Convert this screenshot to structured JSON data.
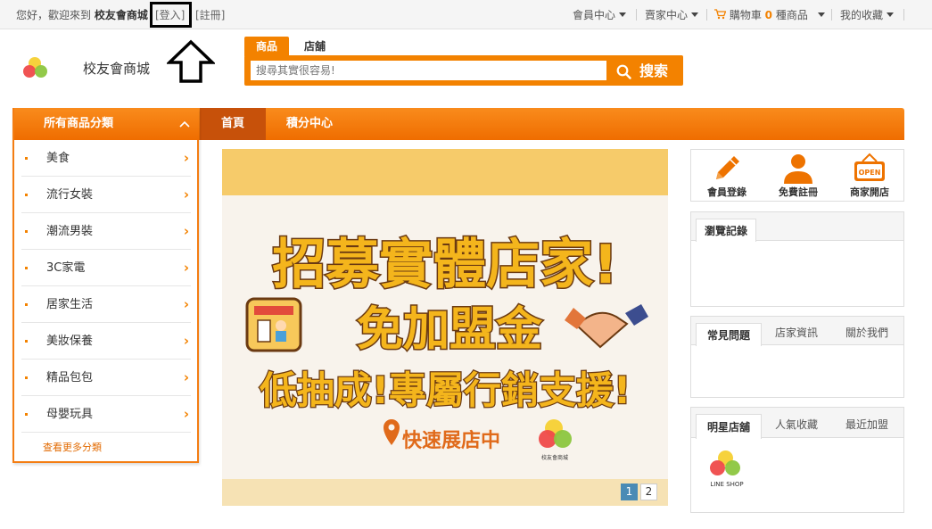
{
  "topbar": {
    "greeting_prefix": "您好，歡迎來到",
    "greeting_site": "校友會商城",
    "login": "[登入]",
    "register": "[註冊]",
    "member_center": "會員中心",
    "seller_center": "賣家中心",
    "cart_prefix": "購物車",
    "cart_count": "0",
    "cart_suffix": "種商品",
    "favorites": "我的收藏"
  },
  "header": {
    "site_name": "校友會商城",
    "search_tabs": [
      "商品",
      "店舖"
    ],
    "search_placeholder": "搜尋其實很容易!",
    "search_button": "搜索"
  },
  "categories": {
    "title": "所有商品分類",
    "items": [
      "美食",
      "流行女裝",
      "潮流男裝",
      "3C家電",
      "居家生活",
      "美妝保養",
      "精品包包",
      "母嬰玩具"
    ],
    "more": "查看更多分類"
  },
  "nav": {
    "tabs": [
      "首頁",
      "積分中心"
    ]
  },
  "banner": {
    "line1": "招募實體店家!",
    "line2": "免加盟金",
    "line3": "低抽成!專屬行銷支援!",
    "tag": "快速展店中",
    "logo_text": "校友會商城",
    "pages": [
      "1",
      "2"
    ]
  },
  "quick_links": [
    "會員登錄",
    "免費註冊",
    "商家開店"
  ],
  "panels": {
    "history": {
      "tabs": [
        "瀏覽記錄"
      ]
    },
    "info": {
      "tabs": [
        "常見問題",
        "店家資訊",
        "關於我們"
      ]
    },
    "stores": {
      "tabs": [
        "明星店舖",
        "人氣收藏",
        "最近加盟"
      ],
      "store_logo_text": "LINE SHOP"
    }
  },
  "colors": {
    "accent": "#f38200",
    "nav_dark": "#c7510a",
    "banner_text": "#f4b51c",
    "banner_stroke": "#6b3a12"
  }
}
